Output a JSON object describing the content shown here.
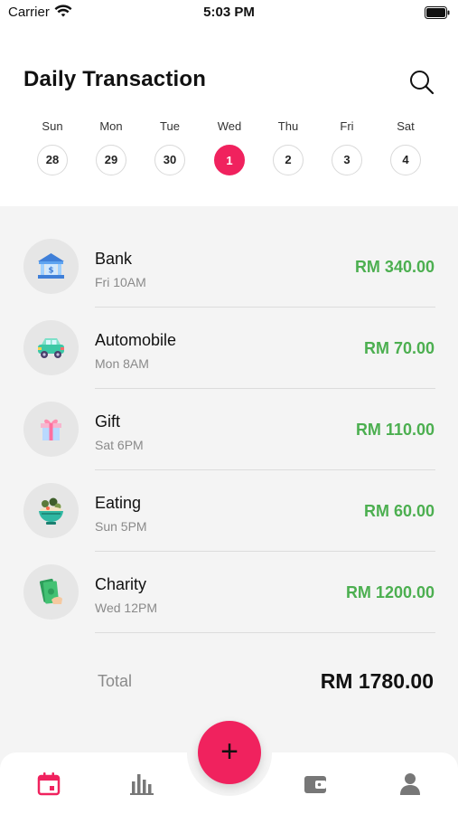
{
  "status_bar": {
    "carrier": "Carrier",
    "time": "5:03 PM"
  },
  "header": {
    "title": "Daily Transaction",
    "search_icon": "search-icon"
  },
  "week": [
    {
      "day": "Sun",
      "date": "28",
      "selected": false
    },
    {
      "day": "Mon",
      "date": "29",
      "selected": false
    },
    {
      "day": "Tue",
      "date": "30",
      "selected": false
    },
    {
      "day": "Wed",
      "date": "1",
      "selected": true
    },
    {
      "day": "Thu",
      "date": "2",
      "selected": false
    },
    {
      "day": "Fri",
      "date": "3",
      "selected": false
    },
    {
      "day": "Sat",
      "date": "4",
      "selected": false
    }
  ],
  "transactions": [
    {
      "name": "Bank",
      "time": "Fri 10AM",
      "amount": "RM 340.00",
      "icon": "bank-icon"
    },
    {
      "name": "Automobile",
      "time": "Mon 8AM",
      "amount": "RM 70.00",
      "icon": "car-icon"
    },
    {
      "name": "Gift",
      "time": "Sat 6PM",
      "amount": "RM 110.00",
      "icon": "gift-icon"
    },
    {
      "name": "Eating",
      "time": "Sun 5PM",
      "amount": "RM 60.00",
      "icon": "food-bowl-icon"
    },
    {
      "name": "Charity",
      "time": "Wed 12PM",
      "amount": "RM 1200.00",
      "icon": "money-hand-icon"
    }
  ],
  "total": {
    "label": "Total",
    "value": "RM 1780.00"
  },
  "tabbar": {
    "fab_label": "+",
    "tabs": [
      "calendar-icon",
      "bar-chart-icon",
      "wallet-icon",
      "profile-icon"
    ]
  },
  "colors": {
    "accent": "#f0225e",
    "amount": "#4caf50",
    "background": "#f4f4f4"
  }
}
